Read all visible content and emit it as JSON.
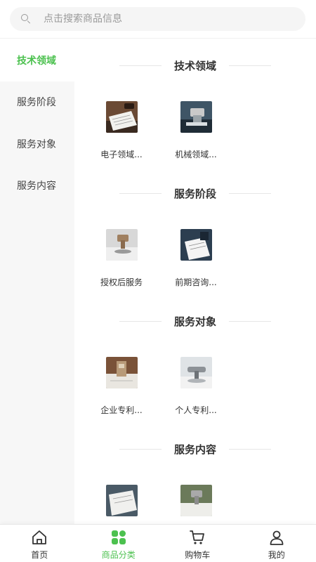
{
  "search": {
    "placeholder": "点击搜索商品信息"
  },
  "sidebar": {
    "items": [
      {
        "label": "技术领域",
        "active": true
      },
      {
        "label": "服务阶段",
        "active": false
      },
      {
        "label": "服务对象",
        "active": false
      },
      {
        "label": "服务内容",
        "active": false
      }
    ]
  },
  "sections": [
    {
      "title": "技术领域",
      "products": [
        {
          "name": "电子领域..."
        },
        {
          "name": "机械领域..."
        }
      ]
    },
    {
      "title": "服务阶段",
      "products": [
        {
          "name": "授权后服务"
        },
        {
          "name": "前期咨询..."
        }
      ]
    },
    {
      "title": "服务对象",
      "products": [
        {
          "name": "企业专利..."
        },
        {
          "name": "个人专利..."
        }
      ]
    },
    {
      "title": "服务内容",
      "products": [
        {
          "name": ""
        },
        {
          "name": ""
        }
      ]
    }
  ],
  "tabbar": {
    "items": [
      {
        "label": "首页",
        "icon": "home-icon",
        "active": false
      },
      {
        "label": "商品分类",
        "icon": "category-icon",
        "active": true
      },
      {
        "label": "购物车",
        "icon": "cart-icon",
        "active": false
      },
      {
        "label": "我的",
        "icon": "user-icon",
        "active": false
      }
    ]
  },
  "colors": {
    "accent": "#4cc14f",
    "sidebar_bg": "#f7f7f7",
    "search_bg": "#f5f5f5"
  }
}
